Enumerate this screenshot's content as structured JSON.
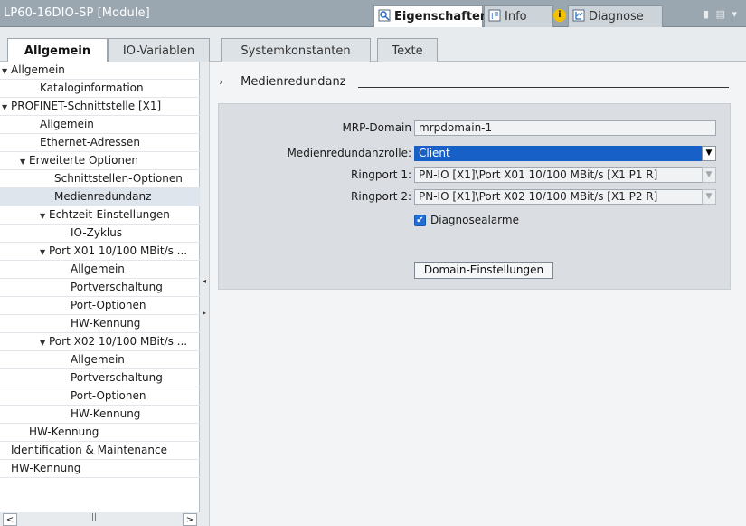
{
  "window": {
    "title": "LP60-16DIO-SP [Module]"
  },
  "panel_tabs": [
    {
      "label": "Eigenschaften",
      "icon": "properties-icon"
    },
    {
      "label": "Info",
      "icon": "info-icon"
    },
    {
      "label": "Diagnose",
      "icon": "diagnose-icon"
    }
  ],
  "tabs": [
    {
      "label": "Allgemein"
    },
    {
      "label": "IO-Variablen"
    },
    {
      "label": "Systemkonstanten"
    },
    {
      "label": "Texte"
    }
  ],
  "nav": [
    {
      "label": "Allgemein",
      "expanded": true
    },
    {
      "label": "Kataloginformation"
    },
    {
      "label": "PROFINET-Schnittstelle [X1]",
      "expanded": true
    },
    {
      "label": "Allgemein"
    },
    {
      "label": "Ethernet-Adressen"
    },
    {
      "label": "Erweiterte Optionen",
      "expanded": true
    },
    {
      "label": "Schnittstellen-Optionen"
    },
    {
      "label": "Medienredundanz",
      "selected": true
    },
    {
      "label": "Echtzeit-Einstellungen",
      "expanded": true
    },
    {
      "label": "IO-Zyklus"
    },
    {
      "label": "Port X01 10/100 MBit/s ...",
      "expanded": true
    },
    {
      "label": "Allgemein"
    },
    {
      "label": "Portverschaltung"
    },
    {
      "label": "Port-Optionen"
    },
    {
      "label": "HW-Kennung"
    },
    {
      "label": "Port X02 10/100 MBit/s ...",
      "expanded": true
    },
    {
      "label": "Allgemein"
    },
    {
      "label": "Portverschaltung"
    },
    {
      "label": "Port-Optionen"
    },
    {
      "label": "HW-Kennung"
    },
    {
      "label": "HW-Kennung"
    },
    {
      "label": "Identification & Maintenance"
    },
    {
      "label": "HW-Kennung"
    }
  ],
  "section": {
    "title": "Medienredundanz"
  },
  "form": {
    "mrp_domain_label": "MRP-Domain",
    "mrp_domain_value": "mrpdomain-1",
    "role_label": "Medienredundanzrolle:",
    "role_value": "Client",
    "ringport1_label": "Ringport 1:",
    "ringport1_value": "PN-IO [X1]\\Port X01 10/100 MBit/s [X1 P1 R]",
    "ringport2_label": "Ringport 2:",
    "ringport2_value": "PN-IO [X1]\\Port X02 10/100 MBit/s [X1 P2 R]",
    "diag_label": "Diagnosealarme",
    "diag_checked": true,
    "domain_button": "Domain-Einstellungen"
  },
  "colors": {
    "selection": "#1660c8",
    "title_bar": "#9aa6b0",
    "checkbox": "#1f6fd6"
  }
}
